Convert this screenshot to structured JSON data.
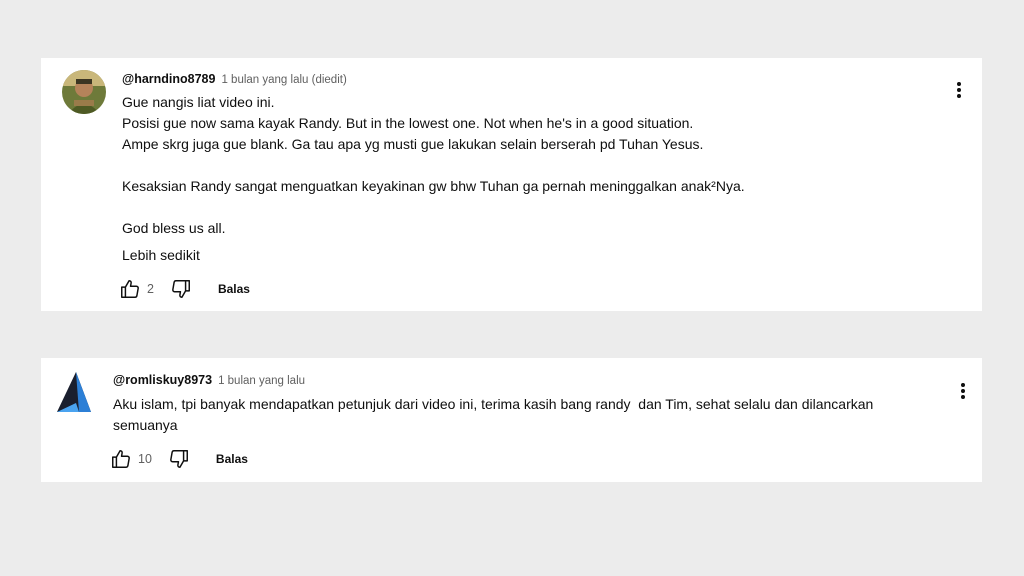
{
  "comments": [
    {
      "handle": "@harndino8789",
      "time": "1 bulan yang lalu (diedit)",
      "lines": [
        "Gue nangis liat video ini.",
        "Posisi gue now sama kayak Randy. But in the lowest one. Not when he's in a good situation.",
        "Ampe skrg juga gue blank. Ga tau apa yg musti gue lakukan selain berserah pd Tuhan Yesus.",
        "",
        "Kesaksian Randy sangat menguatkan keyakinan gw bhw Tuhan ga pernah meninggalkan anak²Nya.",
        "",
        "God bless us all."
      ],
      "more_label": "Lebih sedikit",
      "likes": "2",
      "reply_label": "Balas",
      "avatar_icon": "user-photo-avatar"
    },
    {
      "handle": "@romliskuy8973",
      "time": "1 bulan yang lalu",
      "lines": [
        "Aku islam, tpi banyak mendapatkan petunjuk dari video ini, terima kasih bang randy  dan Tim, sehat selalu dan dilancarkan",
        "semuanya"
      ],
      "likes": "10",
      "reply_label": "Balas",
      "avatar_icon": "triangle-logo-avatar"
    }
  ],
  "colors": {
    "page_bg": "#ececec",
    "card_bg": "#ffffff",
    "text": "#0f0f0f",
    "muted": "#606060"
  }
}
